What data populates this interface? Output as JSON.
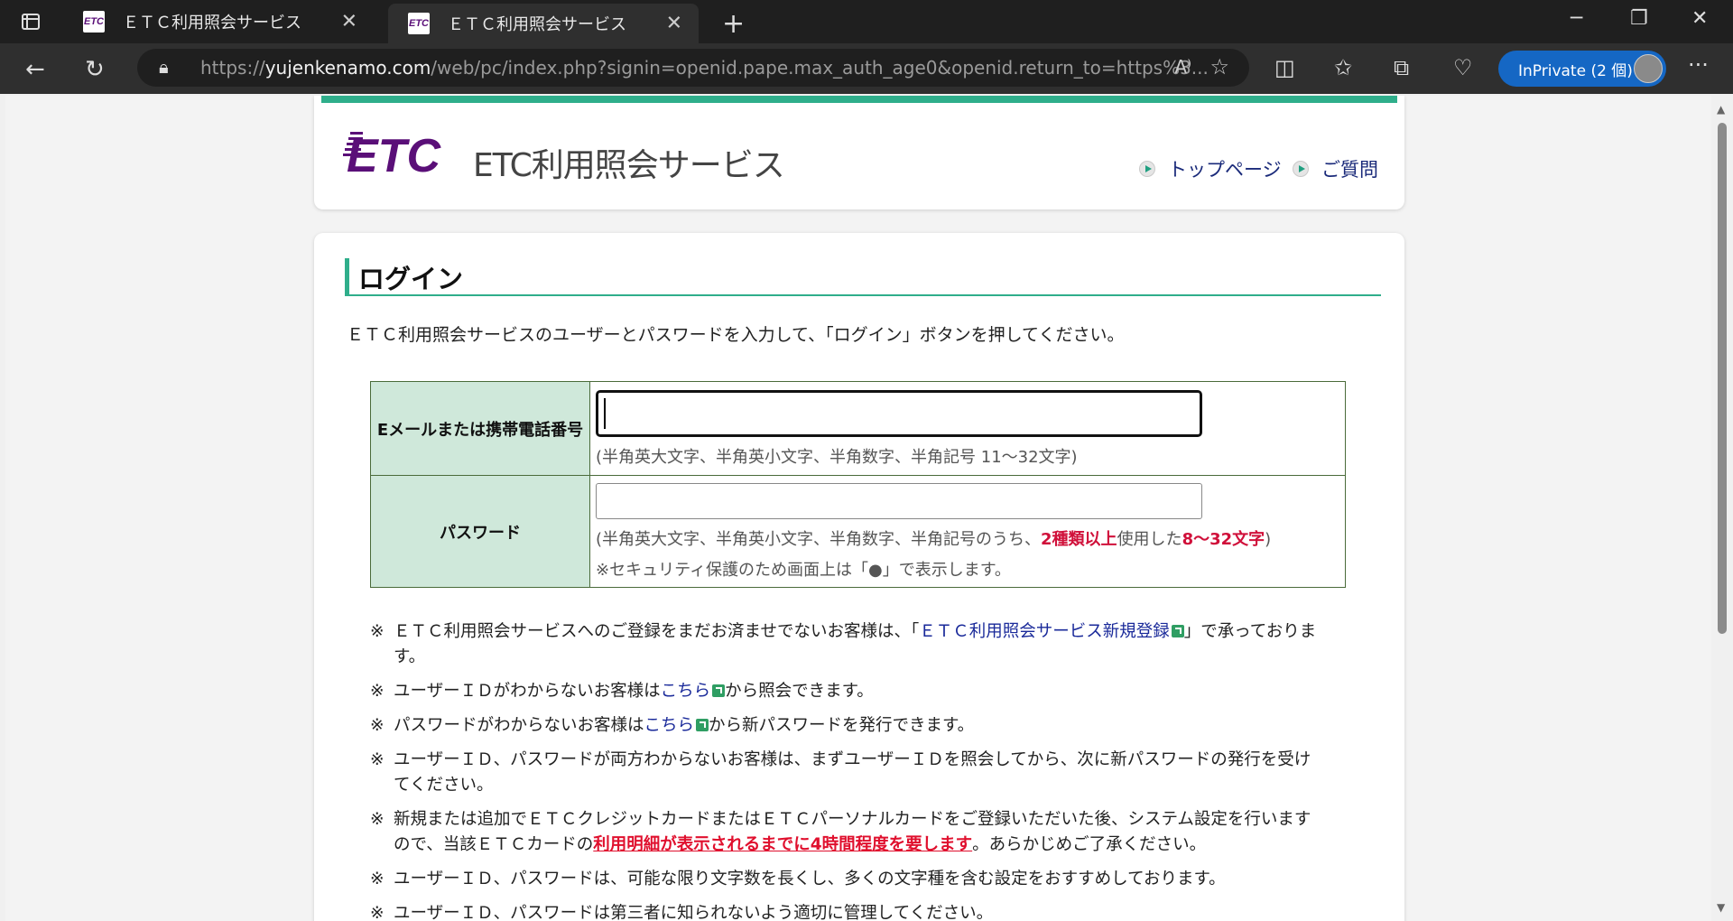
{
  "browser": {
    "tabs": [
      {
        "title": "ＥＴＣ利用照会サービス",
        "active": false
      },
      {
        "title": "ＥＴＣ利用照会サービス",
        "active": true
      }
    ],
    "favicon_text": "ETC",
    "url_prefix": "https://",
    "url_host": "yujenkenamo.com",
    "url_rest": "/web/pc/index.php?signin=openid.pape.max_auth_age0&openid.return_to=https%3...",
    "inprivate_label": "InPrivate (2 個)"
  },
  "header": {
    "logo_mark": "ETC",
    "logo_text": "ETC利用照会サービス",
    "links": [
      "トップページ",
      "ご質問"
    ]
  },
  "login": {
    "heading": "ログイン",
    "intro": "ＥＴＣ利用照会サービスのユーザーとパスワードを入力して、「ログイン」ボタンを押してください。",
    "email_label": "Eメールまたは携帯電話番号",
    "email_note": "(半角英大文字、半角英小文字、半角数字、半角記号 11～32文字)",
    "password_label": "パスワード",
    "password_note_a": "(半角英大文字、半角英小文字、半角数字、半角記号のうち、",
    "password_note_b": "2種類以上",
    "password_note_c": "使用した",
    "password_note_d": "8～32文字",
    "password_note_e": ")",
    "password_note2": "※セキュリティ保護のため画面上は「●」で表示します。"
  },
  "notes": {
    "mark": "※",
    "n1a": "ＥＴＣ利用照会サービスへのご登録をまだお済ませでないお客様は、「",
    "n1link": "ＥＴＣ利用照会サービス新規登録",
    "n1b": "」で承っております。",
    "n2a": "ユーザーＩＤがわからないお客様は",
    "n2link": "こちら",
    "n2b": "から照会できます。",
    "n3a": "パスワードがわからないお客様は",
    "n3link": "こちら",
    "n3b": "から新パスワードを発行できます。",
    "n4": "ユーザーＩＤ、パスワードが両方わからないお客様は、まずユーザーＩＤを照会してから、次に新パスワードの発行を受けてください。",
    "n5a": "新規または追加でＥＴＣクレジットカードまたはＥＴＣパーソナルカードをご登録いただいた後、システム設定を行いますので、当該ＥＴＣカードの",
    "n5red": "利用明細が表示されるまでに4時間程度を要します",
    "n5b": "。あらかじめご了承ください。",
    "n6": "ユーザーＩＤ、パスワードは、可能な限り文字数を長くし、多くの文字種を含む設定をおすすめしております。",
    "n7": "ユーザーＩＤ、パスワードは第三者に知られないよう適切に管理してください。"
  }
}
